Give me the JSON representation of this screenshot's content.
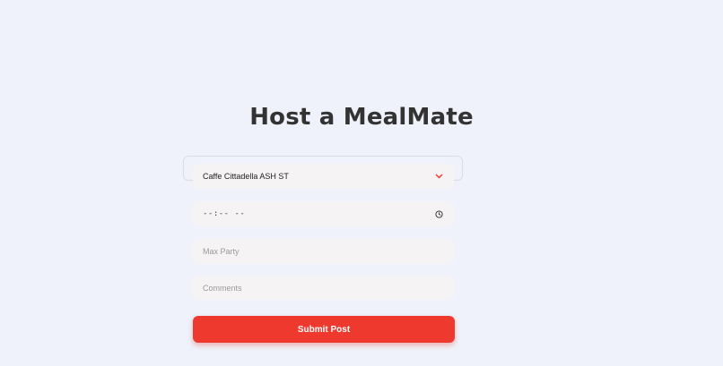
{
  "page": {
    "title": "Host a MealMate"
  },
  "form": {
    "restaurant_select": {
      "value": "Caffe Cittadella ASH ST",
      "icon": "chevron-down-icon"
    },
    "time_input": {
      "value": "--:-- --",
      "icon": "clock-icon"
    },
    "max_party": {
      "placeholder": "Max Party"
    },
    "comments": {
      "placeholder": "Comments"
    },
    "submit_label": "Submit Post"
  },
  "colors": {
    "background": "#eff2fa",
    "accent": "#ee3a2e",
    "field_bg": "#f5f3f4",
    "title": "#333333"
  }
}
